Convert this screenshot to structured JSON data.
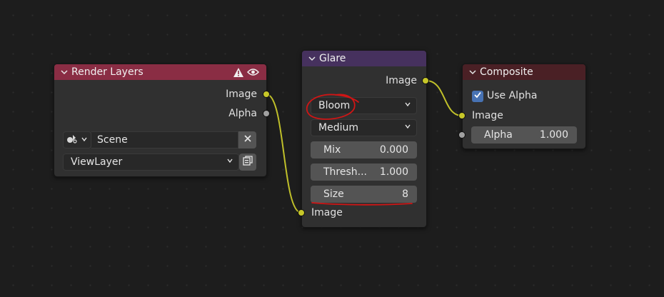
{
  "colors": {
    "render_layers_header": "#8a2d44",
    "glare_header": "#46315e",
    "composite_header": "#4a2025",
    "socket_image": "#c7c729",
    "socket_value": "#a1a1a1",
    "wire": "#c0c02a",
    "annotation": "#d01515",
    "accent_checkbox": "#4772b3"
  },
  "render_layers": {
    "title": "Render Layers",
    "outputs": {
      "image": "Image",
      "alpha": "Alpha"
    },
    "scene_value": "Scene",
    "view_layer_value": "ViewLayer",
    "icons": [
      "warning-icon",
      "eye-icon",
      "scene-icon",
      "close-icon",
      "copy-icon"
    ]
  },
  "glare": {
    "title": "Glare",
    "output": "Image",
    "type_value": "Bloom",
    "quality_value": "Medium",
    "mix": {
      "label": "Mix",
      "value": "0.000"
    },
    "threshold": {
      "label": "Thresh...",
      "value": "1.000"
    },
    "size": {
      "label": "Size",
      "value": "8"
    },
    "input": "Image"
  },
  "composite": {
    "title": "Composite",
    "use_alpha_label": "Use Alpha",
    "use_alpha_checked": true,
    "input_image": "Image",
    "alpha": {
      "label": "Alpha",
      "value": "1.000"
    }
  }
}
